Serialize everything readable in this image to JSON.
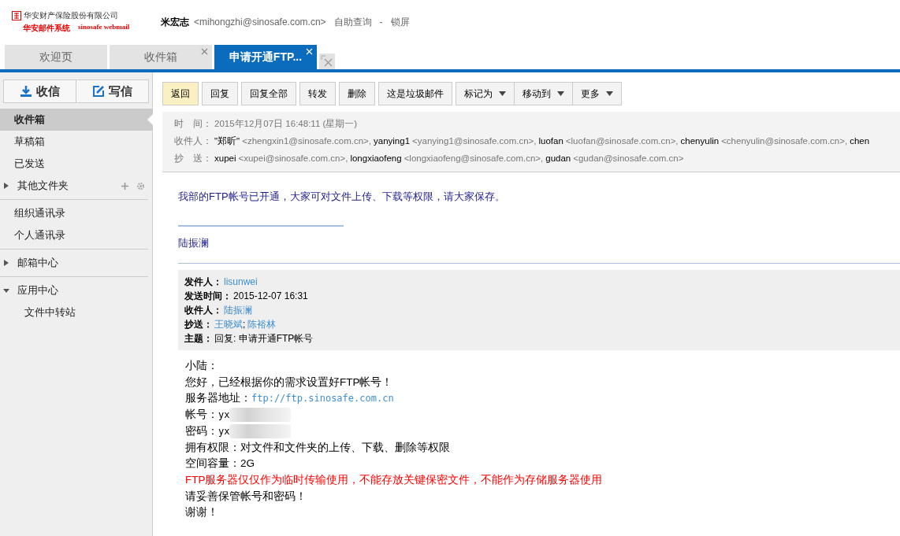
{
  "header": {
    "company": "华安财产保险股份有限公司",
    "system_name": "华安邮件系统",
    "webmail": "sinosafe webmail",
    "user_name": "米宏志",
    "user_email": "<mihongzhi@sinosafe.com.cn>",
    "links": [
      "自助查询",
      "锁屏"
    ],
    "separator": "-"
  },
  "tabs": [
    {
      "label": "欢迎页",
      "selected": false,
      "closable": false
    },
    {
      "label": "收件箱",
      "selected": false,
      "closable": true
    },
    {
      "label": "申请开通FTP...",
      "selected": true,
      "closable": true
    }
  ],
  "sidebar": {
    "actions": [
      {
        "label": "收信",
        "kind": "receive"
      },
      {
        "label": "写信",
        "kind": "compose"
      }
    ],
    "sections": [
      [
        {
          "label": "收件箱",
          "selected": true,
          "kind": "item"
        },
        {
          "label": "草稿箱",
          "selected": false,
          "kind": "item"
        },
        {
          "label": "已发送",
          "selected": false,
          "kind": "item"
        },
        {
          "label": "其他文件夹",
          "selected": false,
          "kind": "group",
          "expanded": false,
          "tools": true
        }
      ],
      [
        {
          "label": "组织通讯录",
          "selected": false,
          "kind": "item"
        },
        {
          "label": "个人通讯录",
          "selected": false,
          "kind": "item"
        }
      ],
      [
        {
          "label": "邮箱中心",
          "selected": false,
          "kind": "group",
          "expanded": false,
          "tools": false
        }
      ],
      [
        {
          "label": "应用中心",
          "selected": false,
          "kind": "group",
          "expanded": true,
          "tools": false,
          "children": [
            {
              "label": "文件中转站",
              "selected": false
            }
          ]
        }
      ]
    ]
  },
  "toolbar": [
    [
      {
        "label": "返回",
        "highlighted": true,
        "dropdown": false
      }
    ],
    [
      {
        "label": "回复",
        "highlighted": false,
        "dropdown": false
      }
    ],
    [
      {
        "label": "回复全部",
        "highlighted": false,
        "dropdown": false
      }
    ],
    [
      {
        "label": "转发",
        "highlighted": false,
        "dropdown": false
      }
    ],
    [
      {
        "label": "删除",
        "highlighted": false,
        "dropdown": false
      }
    ],
    [
      {
        "label": "这是垃圾邮件",
        "highlighted": false,
        "dropdown": false
      }
    ],
    [
      {
        "label": "标记为",
        "highlighted": false,
        "dropdown": true
      },
      {
        "label": "移动到",
        "highlighted": false,
        "dropdown": true
      },
      {
        "label": "更多",
        "highlighted": false,
        "dropdown": true
      }
    ]
  ],
  "message": {
    "time_label": "时　间：",
    "time": "2015年12月07日 16:48:11 (星期一)",
    "to_label": "收件人：",
    "to": [
      {
        "name": "\"郑昕\"",
        "email": "<zhengxin1@sinosafe.com.cn>,"
      },
      {
        "name": "yanying1",
        "email": "<yanying1@sinosafe.com.cn>,"
      },
      {
        "name": "luofan",
        "email": "<luofan@sinosafe.com.cn>,"
      },
      {
        "name": "chenyulin",
        "email": "<chenyulin@sinosafe.com.cn>,"
      },
      {
        "name": "chen"
      }
    ],
    "cc_label": "抄　送：",
    "cc": [
      {
        "name": "xupei",
        "email": "<xupei@sinosafe.com.cn>,"
      },
      {
        "name": "longxiaofeng",
        "email": "<longxiaofeng@sinosafe.com.cn>,"
      },
      {
        "name": "gudan",
        "email": "<gudan@sinosafe.com.cn>"
      }
    ],
    "intro": "我部的FTP帐号已开通，大家可对文件上传、下载等权限，请大家保存。",
    "signature": "陆振澜",
    "quote": [
      {
        "label": "发件人：",
        "values": [
          "lisunwei"
        ],
        "link": true
      },
      {
        "label": "发送时间：",
        "values": [
          "2015-12-07 16:31"
        ],
        "link": false
      },
      {
        "label": "收件人：",
        "values": [
          "陆振澜"
        ],
        "link": true
      },
      {
        "label": "抄送：",
        "values": [
          "王晓斌",
          "陈裕林"
        ],
        "link": true
      },
      {
        "label": "主题：",
        "values": [
          "回复: 申请开通FTP帐号"
        ],
        "link": false
      }
    ],
    "quote_separator": ";",
    "body": [
      {
        "kind": "text",
        "text": "小陆："
      },
      {
        "kind": "text",
        "text": "您好，已经根据你的需求设置好FTP帐号！"
      },
      {
        "kind": "link",
        "label": "服务器地址：",
        "value": "ftp://ftp.sinosafe.com.cn"
      },
      {
        "kind": "redacted",
        "label": "帐号：",
        "value": "yx"
      },
      {
        "kind": "redacted",
        "label": "密码：",
        "value": "yx"
      },
      {
        "kind": "text",
        "text": "拥有权限：对文件和文件夹的上传、下载、删除等权限"
      },
      {
        "kind": "text",
        "text": "空间容量：2G"
      },
      {
        "kind": "warning",
        "text": "FTP服务器仅仅作为临时传输使用，不能存放关键保密文件，不能作为存储服务器使用"
      },
      {
        "kind": "text",
        "text": "请妥善保管帐号和密码！"
      },
      {
        "kind": "text",
        "text": "谢谢！"
      }
    ]
  }
}
